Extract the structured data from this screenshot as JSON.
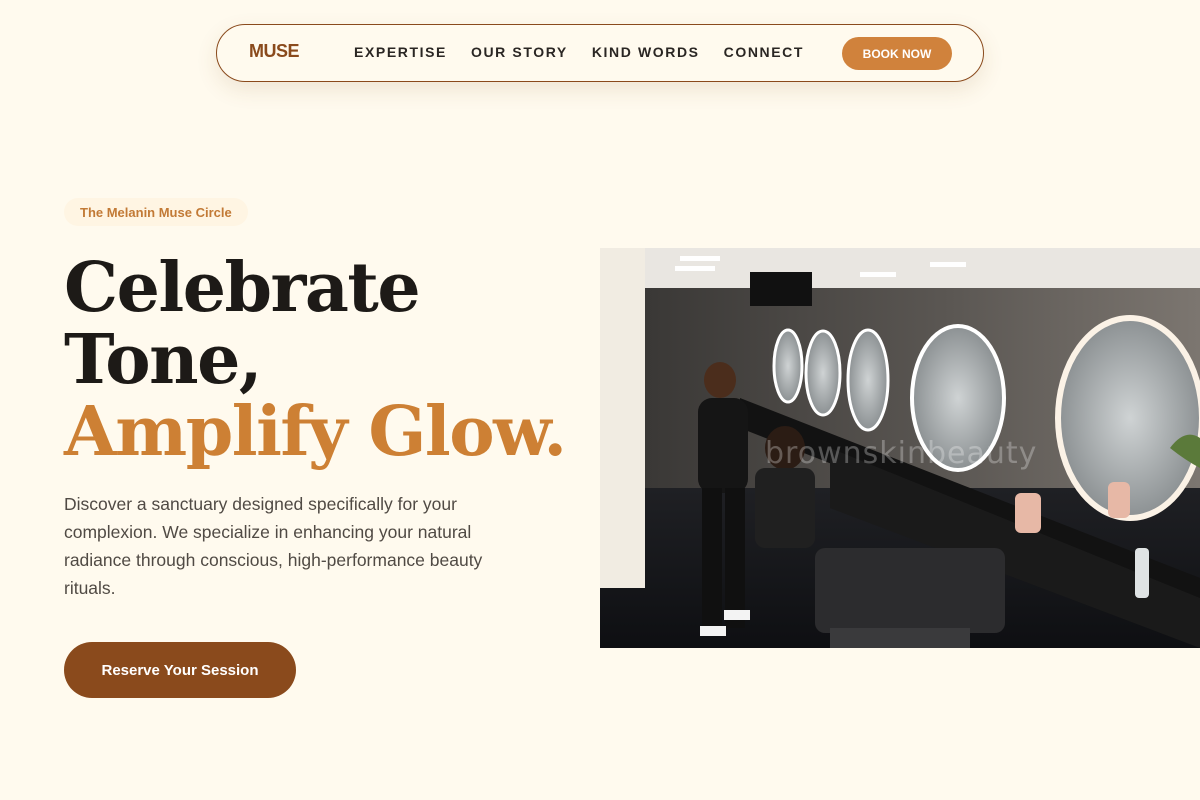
{
  "nav": {
    "logo": "MUSE",
    "links": [
      "EXPERTISE",
      "OUR STORY",
      "KIND WORDS",
      "CONNECT"
    ],
    "cta": "BOOK NOW"
  },
  "hero": {
    "eyebrow": "The Melanin Muse Circle",
    "headline_line1": "Celebrate",
    "headline_line2": "Tone,",
    "headline_accent": "Amplify Glow.",
    "description": "Discover a sanctuary designed specifically for your complexion. We specialize in enhancing your natural radiance through conscious, high-performance beauty rituals.",
    "cta": "Reserve Your Session"
  },
  "image": {
    "watermark": "brownskinbeauty"
  },
  "colors": {
    "background": "#fffaee",
    "brand_brown": "#8a4a1c",
    "accent_copper": "#cd8034",
    "book_button": "#d0823c"
  }
}
